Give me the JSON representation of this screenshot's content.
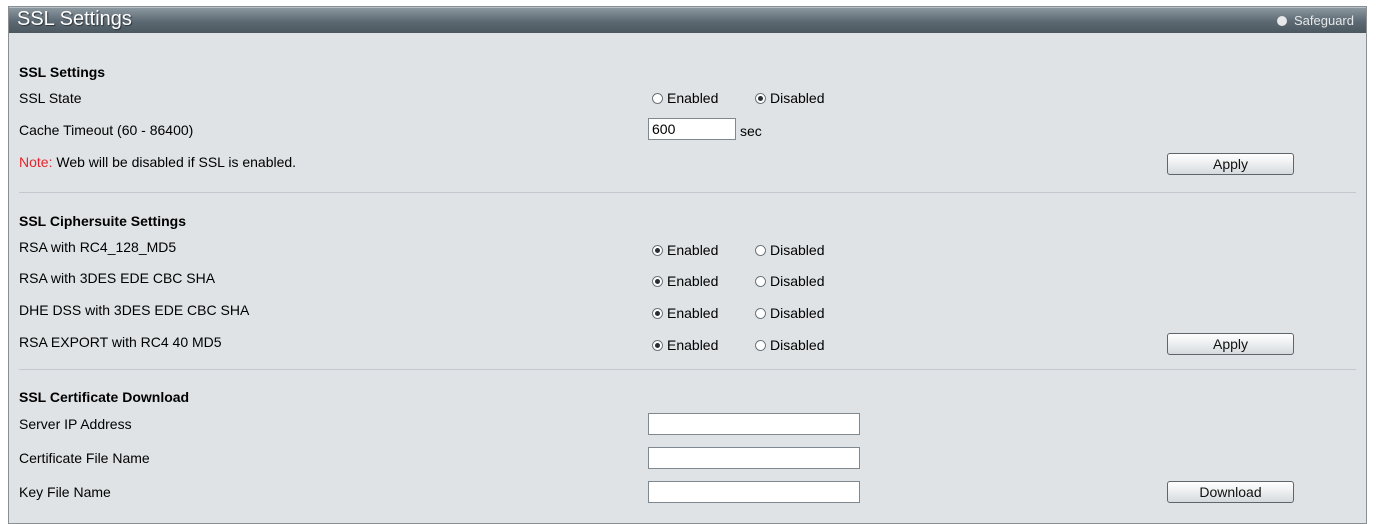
{
  "header": {
    "title": "SSL Settings",
    "brand": "Safeguard",
    "brand_icon": "safeguard-icon"
  },
  "ssl_settings": {
    "section_title": "SSL Settings",
    "ssl_state": {
      "label": "SSL State",
      "enabled_label": "Enabled",
      "disabled_label": "Disabled",
      "selected": "Disabled"
    },
    "cache_timeout": {
      "label": "Cache Timeout (60 - 86400)",
      "value": "600",
      "unit": "sec"
    },
    "note_prefix": "Note:",
    "note_text": " Web will be disabled if SSL is enabled.",
    "apply_label": "Apply"
  },
  "ciphersuite": {
    "section_title": "SSL Ciphersuite Settings",
    "rows": [
      {
        "label": "RSA with RC4_128_MD5",
        "enabled_label": "Enabled",
        "disabled_label": "Disabled",
        "selected": "Enabled"
      },
      {
        "label": "RSA with 3DES EDE CBC SHA",
        "enabled_label": "Enabled",
        "disabled_label": "Disabled",
        "selected": "Enabled"
      },
      {
        "label": "DHE DSS with 3DES EDE CBC SHA",
        "enabled_label": "Enabled",
        "disabled_label": "Disabled",
        "selected": "Enabled"
      },
      {
        "label": "RSA EXPORT with RC4 40 MD5",
        "enabled_label": "Enabled",
        "disabled_label": "Disabled",
        "selected": "Enabled"
      }
    ],
    "apply_label": "Apply"
  },
  "certificate": {
    "section_title": "SSL Certificate Download",
    "server_ip": {
      "label": "Server IP Address",
      "value": ""
    },
    "cert_file": {
      "label": "Certificate File Name",
      "value": ""
    },
    "key_file": {
      "label": "Key File Name",
      "value": ""
    },
    "download_label": "Download"
  },
  "colors": {
    "note": "#e3272d",
    "titlebar": "#5d6a73",
    "panel": "#dfe3e6"
  }
}
